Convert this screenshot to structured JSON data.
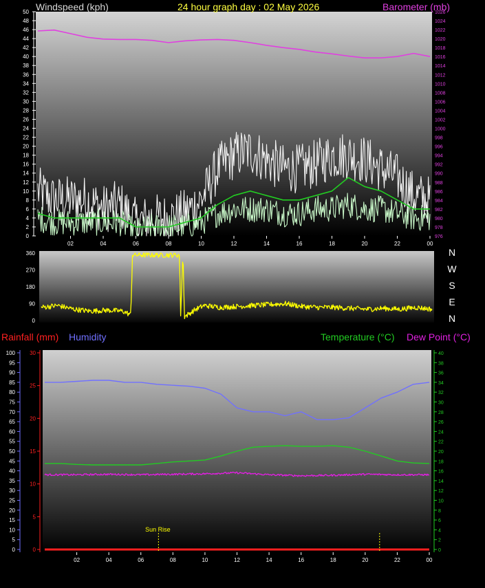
{
  "header": {
    "wind_label": "Windspeed (kph)",
    "title": "24 hour graph day : 02 May 2026",
    "baro_label": "Barometer (mb)"
  },
  "direction_letters": [
    "N",
    "W",
    "S",
    "E",
    "N"
  ],
  "lower_header": {
    "rain_label": "Rainfall (mm)",
    "humidity_label": "Humidity",
    "temp_label": "Temperature (°C)",
    "dew_label": "Dew Point (°C)"
  },
  "colors": {
    "wind_label": "#d9d9d9",
    "title": "#ffff40",
    "baro": "#e040e0",
    "gust": "#f2f2f2",
    "avg": "#22cc22",
    "speed": "#c8f7c8",
    "direction": "#ffff00",
    "rain": "#ff2020",
    "humidity": "#7070ff",
    "temperature": "#22cc22",
    "dewpoint": "#e020e0",
    "sun": "#ffff00"
  },
  "time_ticks": [
    "02",
    "04",
    "06",
    "08",
    "10",
    "12",
    "14",
    "16",
    "18",
    "20",
    "22",
    "00"
  ],
  "chart_data": [
    {
      "type": "line",
      "title": "24 hour graph day : 02 May 2026",
      "x_unit": "hour",
      "xlim": [
        0,
        24
      ],
      "left_axis": {
        "label": "Windspeed (kph)",
        "ylim": [
          0,
          50
        ],
        "tick_step": 2
      },
      "right_axis": {
        "label": "Barometer (mb)",
        "ylim": [
          976,
          1026
        ],
        "tick_step": 2
      },
      "grid": false,
      "series": [
        {
          "name": "Barometer (mb)",
          "axis": "right",
          "color": "#e040e0",
          "points": [
            [
              0,
              1021.7
            ],
            [
              1,
              1021.9
            ],
            [
              2,
              1021.1
            ],
            [
              3,
              1020.3
            ],
            [
              4,
              1019.9
            ],
            [
              5,
              1019.8
            ],
            [
              6,
              1019.8
            ],
            [
              7,
              1019.6
            ],
            [
              8,
              1019.1
            ],
            [
              9,
              1019.5
            ],
            [
              10,
              1019.7
            ],
            [
              11,
              1019.8
            ],
            [
              12,
              1019.6
            ],
            [
              13,
              1019.1
            ],
            [
              14,
              1018.5
            ],
            [
              15,
              1018.0
            ],
            [
              16,
              1017.6
            ],
            [
              17,
              1017.0
            ],
            [
              18,
              1016.6
            ],
            [
              19,
              1016.1
            ],
            [
              20,
              1015.7
            ],
            [
              21,
              1015.7
            ],
            [
              22,
              1016.0
            ],
            [
              23,
              1016.7
            ],
            [
              24,
              1016.0
            ]
          ]
        },
        {
          "name": "Wind gust",
          "axis": "left",
          "color": "#f2f2f2",
          "style": "noisy",
          "points": [
            [
              0,
              10
            ],
            [
              1,
              8
            ],
            [
              2,
              8
            ],
            [
              3,
              8
            ],
            [
              4,
              6
            ],
            [
              5,
              7
            ],
            [
              6,
              3
            ],
            [
              7,
              4
            ],
            [
              8,
              4
            ],
            [
              9,
              5
            ],
            [
              10,
              8
            ],
            [
              11,
              15
            ],
            [
              12,
              18
            ],
            [
              13,
              19
            ],
            [
              14,
              17
            ],
            [
              15,
              15
            ],
            [
              16,
              15
            ],
            [
              17,
              16
            ],
            [
              18,
              18
            ],
            [
              19,
              18
            ],
            [
              20,
              17
            ],
            [
              21,
              15
            ],
            [
              22,
              13
            ],
            [
              23,
              9
            ],
            [
              24,
              8
            ]
          ]
        },
        {
          "name": "Wind average",
          "axis": "left",
          "color": "#22cc22",
          "points": [
            [
              0,
              5
            ],
            [
              1,
              4
            ],
            [
              2,
              4
            ],
            [
              3,
              4
            ],
            [
              4,
              4
            ],
            [
              5,
              4
            ],
            [
              6,
              2
            ],
            [
              7,
              2
            ],
            [
              8,
              2
            ],
            [
              9,
              3
            ],
            [
              10,
              4
            ],
            [
              11,
              7
            ],
            [
              12,
              9
            ],
            [
              13,
              10
            ],
            [
              14,
              9
            ],
            [
              15,
              8
            ],
            [
              16,
              8
            ],
            [
              17,
              9
            ],
            [
              18,
              10
            ],
            [
              19,
              13
            ],
            [
              20,
              11
            ],
            [
              21,
              10
            ],
            [
              22,
              8
            ],
            [
              23,
              6
            ],
            [
              24,
              6
            ]
          ]
        },
        {
          "name": "Wind speed",
          "axis": "left",
          "color": "#c8f7c8",
          "style": "noisy",
          "points": [
            [
              0,
              4
            ],
            [
              1,
              3
            ],
            [
              2,
              3
            ],
            [
              3,
              3
            ],
            [
              4,
              3
            ],
            [
              5,
              3
            ],
            [
              6,
              1
            ],
            [
              7,
              2
            ],
            [
              8,
              2
            ],
            [
              9,
              2
            ],
            [
              10,
              3
            ],
            [
              11,
              5
            ],
            [
              12,
              6
            ],
            [
              13,
              6
            ],
            [
              14,
              6
            ],
            [
              15,
              5
            ],
            [
              16,
              5
            ],
            [
              17,
              6
            ],
            [
              18,
              6
            ],
            [
              19,
              7
            ],
            [
              20,
              6
            ],
            [
              21,
              6
            ],
            [
              22,
              5
            ],
            [
              23,
              4
            ],
            [
              24,
              4
            ]
          ]
        }
      ]
    },
    {
      "type": "line",
      "x_unit": "hour",
      "xlim": [
        0,
        24
      ],
      "ylim": [
        0,
        360
      ],
      "yticks": [
        0,
        90,
        180,
        270,
        360
      ],
      "series": [
        {
          "name": "Wind direction",
          "color": "#ffff00",
          "style": "noisy",
          "points": [
            [
              0,
              70
            ],
            [
              1,
              80
            ],
            [
              2,
              60
            ],
            [
              3,
              50
            ],
            [
              4,
              55
            ],
            [
              5,
              50
            ],
            [
              5.5,
              30
            ],
            [
              5.6,
              350
            ],
            [
              8.5,
              350
            ],
            [
              8.55,
              10
            ],
            [
              8.7,
              360
            ],
            [
              8.8,
              20
            ],
            [
              9.5,
              60
            ],
            [
              10,
              80
            ],
            [
              11,
              70
            ],
            [
              12,
              75
            ],
            [
              13,
              80
            ],
            [
              14,
              85
            ],
            [
              15,
              90
            ],
            [
              16,
              75
            ],
            [
              17,
              70
            ],
            [
              18,
              70
            ],
            [
              19,
              65
            ],
            [
              20,
              60
            ],
            [
              21,
              65
            ],
            [
              22,
              60
            ],
            [
              23,
              70
            ],
            [
              24,
              60
            ]
          ]
        }
      ]
    },
    {
      "type": "line",
      "x_unit": "hour",
      "xlim": [
        0,
        24
      ],
      "axes": {
        "humidity": {
          "label": "Humidity",
          "ylim": [
            0,
            100
          ],
          "tick_step": 5
        },
        "rain": {
          "label": "Rainfall (mm)",
          "ylim": [
            0,
            30
          ],
          "tick_step": 5
        },
        "temperature": {
          "label": "Temperature (°C)",
          "ylim": [
            0,
            40
          ],
          "tick_step": 2
        }
      },
      "series": [
        {
          "name": "Humidity",
          "axis": "humidity",
          "color": "#7070ff",
          "points": [
            [
              0,
              85
            ],
            [
              1,
              85
            ],
            [
              2,
              85.5
            ],
            [
              3,
              86
            ],
            [
              4,
              86
            ],
            [
              5,
              85
            ],
            [
              6,
              85
            ],
            [
              7,
              84
            ],
            [
              8,
              83.5
            ],
            [
              9,
              83
            ],
            [
              10,
              82
            ],
            [
              11,
              79
            ],
            [
              12,
              72
            ],
            [
              13,
              70
            ],
            [
              14,
              70
            ],
            [
              15,
              68
            ],
            [
              16,
              70
            ],
            [
              17,
              66
            ],
            [
              18,
              66
            ],
            [
              19,
              67
            ],
            [
              20,
              72
            ],
            [
              21,
              77
            ],
            [
              22,
              80
            ],
            [
              23,
              84
            ],
            [
              24,
              85
            ]
          ]
        },
        {
          "name": "Temperature (°C)",
          "axis": "temperature",
          "color": "#22cc22",
          "points": [
            [
              0,
              17.5
            ],
            [
              1,
              17.5
            ],
            [
              2,
              17.3
            ],
            [
              3,
              17.2
            ],
            [
              4,
              17.2
            ],
            [
              5,
              17.2
            ],
            [
              6,
              17.2
            ],
            [
              7,
              17.5
            ],
            [
              8,
              17.8
            ],
            [
              9,
              18.0
            ],
            [
              10,
              18.2
            ],
            [
              11,
              19.0
            ],
            [
              12,
              20.0
            ],
            [
              13,
              20.8
            ],
            [
              14,
              21.0
            ],
            [
              15,
              21.1
            ],
            [
              16,
              21.0
            ],
            [
              17,
              21.0
            ],
            [
              18,
              21.1
            ],
            [
              19,
              20.8
            ],
            [
              20,
              20.0
            ],
            [
              21,
              19.0
            ],
            [
              22,
              18.0
            ],
            [
              23,
              17.6
            ],
            [
              24,
              17.5
            ]
          ]
        },
        {
          "name": "Dew Point (°C)",
          "axis": "temperature",
          "color": "#e020e0",
          "style": "noisy",
          "points": [
            [
              0,
              15.2
            ],
            [
              2,
              15.2
            ],
            [
              4,
              15.3
            ],
            [
              6,
              15.2
            ],
            [
              8,
              15.3
            ],
            [
              10,
              15.4
            ],
            [
              12,
              15.6
            ],
            [
              14,
              15.2
            ],
            [
              16,
              15.0
            ],
            [
              18,
              15.1
            ],
            [
              20,
              15.3
            ],
            [
              22,
              15.2
            ],
            [
              24,
              15.2
            ]
          ]
        },
        {
          "name": "Rainfall (mm)",
          "axis": "rain",
          "color": "#ff2020",
          "points": [
            [
              0,
              0
            ],
            [
              24,
              0
            ]
          ]
        }
      ],
      "annotations": [
        {
          "label": "Sun Rise",
          "x": 7.1
        },
        {
          "label": "",
          "x": 20.9
        }
      ]
    }
  ]
}
